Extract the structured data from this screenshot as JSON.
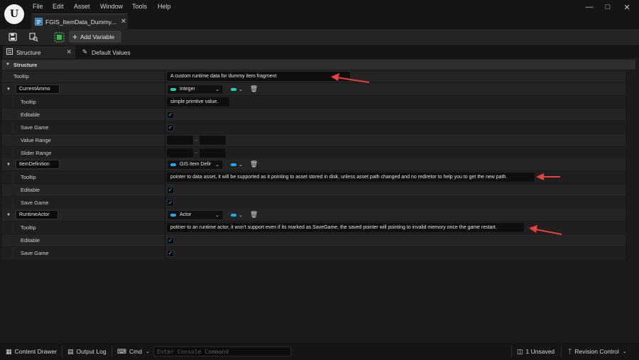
{
  "app": {
    "logo_text": "U",
    "menu": [
      "File",
      "Edit",
      "Asset",
      "Window",
      "Tools",
      "Help"
    ],
    "document_tab": "FGIS_ItemData_Dummy..."
  },
  "toolbar": {
    "add_variable_label": "Add Variable"
  },
  "panel_tabs": {
    "structure": "Structure",
    "default_values": "Default Values"
  },
  "structure": {
    "section_title": "Structure",
    "tooltip_label": "Tooltip",
    "tooltip_value": "A custom runtime data for dummy item fragment",
    "variables": [
      {
        "name": "CurrentAmmo",
        "type": "Integer",
        "type_color": "#1fd1b0",
        "container_color": "#1fd1b0",
        "properties": {
          "tooltip_label": "Tooltip",
          "tooltip_value": "simple primtive value.",
          "editable_label": "Editable",
          "editable": true,
          "save_game_label": "Save Game",
          "save_game": true,
          "value_range_label": "Value Range",
          "slider_range_label": "Slider Range",
          "range_separator": "–"
        }
      },
      {
        "name": "ItemDefinition",
        "type": "GIS Item Defir",
        "type_color": "#21a7f0",
        "container_color": "#21a7f0",
        "properties": {
          "tooltip_label": "Tooltip",
          "tooltip_value": "pointer to data asset, it will be supported as it pointing to asset stored in disk, unless asset path changed and no rediretor to help you to get the new path.",
          "editable_label": "Editable",
          "editable": true,
          "save_game_label": "Save Game",
          "save_game": true
        }
      },
      {
        "name": "RuntimeActor",
        "type": "Actor",
        "type_color": "#21a7f0",
        "container_color": "#21a7f0",
        "properties": {
          "tooltip_label": "Tooltip",
          "tooltip_value": "potiner to an runtime actor, it won't support even if its marked as SaveGame, the saved pointer will pointing to invalid memory once the game restart.",
          "editable_label": "Editable",
          "editable": true,
          "save_game_label": "Save Game",
          "save_game": true
        }
      }
    ]
  },
  "statusbar": {
    "content_drawer": "Content Drawer",
    "output_log": "Output Log",
    "cmd": "Cmd",
    "console_placeholder": "Enter Console Command",
    "unsaved": "1 Unsaved",
    "revision_control": "Revision Control"
  },
  "colors": {
    "accent_checkbox": "#4aa3ff",
    "annotation_arrow": "#e8413c",
    "add_variable_icon": "#3fb34f"
  }
}
